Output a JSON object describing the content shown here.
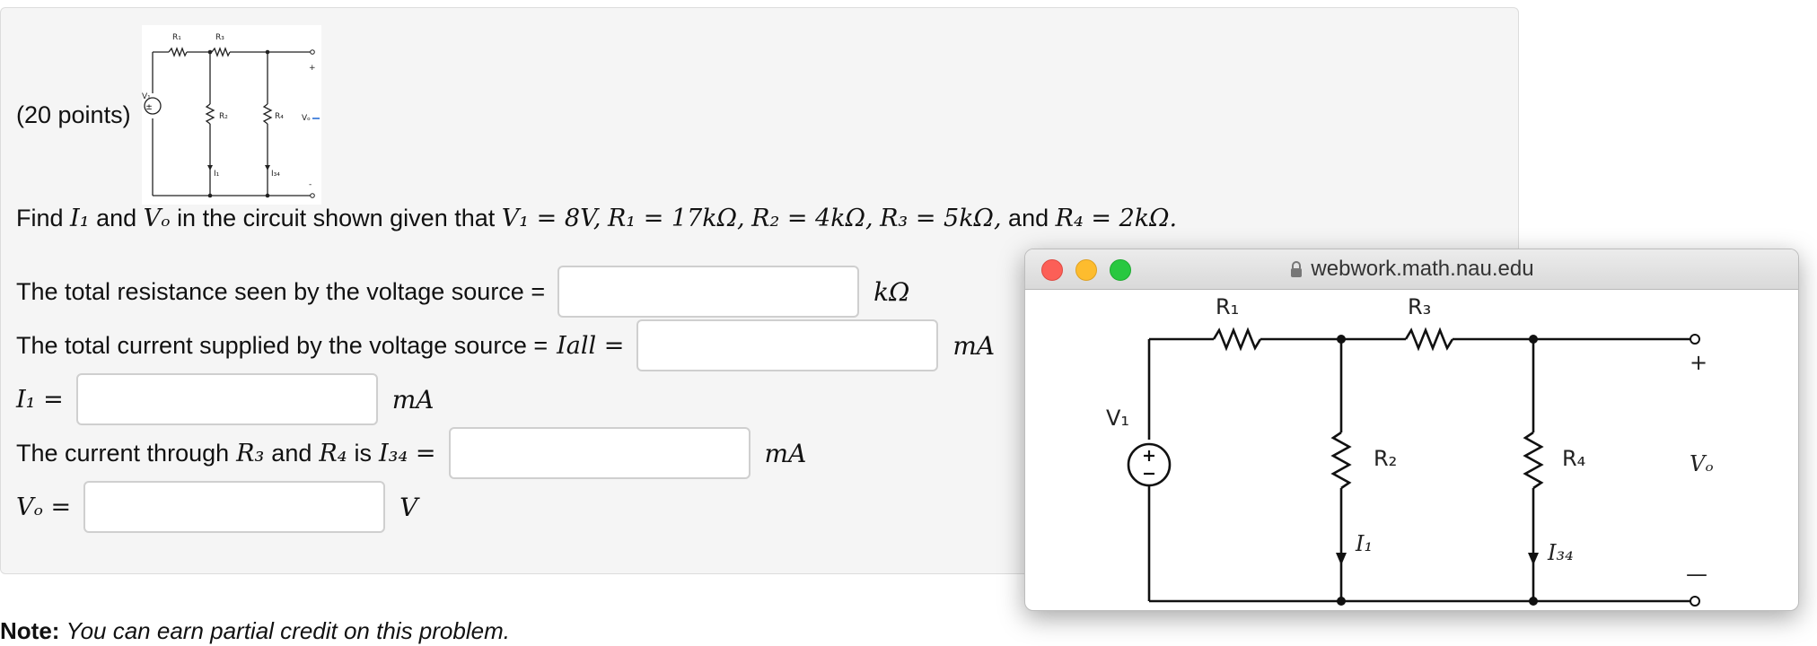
{
  "problem": {
    "points": "(20 points)",
    "statement": {
      "find": "Find",
      "var1": "I₁",
      "and1": "and",
      "var2": "Vₒ",
      "rest": "in the circuit shown given that",
      "v1": "V₁ = 8V,",
      "r1": "R₁ = 17kΩ,",
      "r2": "R₂ = 4kΩ,",
      "r3": "R₃ = 5kΩ,",
      "and2": "and",
      "r4": "R₄ = 2kΩ."
    },
    "questions": [
      {
        "prefix_text": "The total resistance seen by the voltage source =",
        "math": "",
        "unit": "kΩ",
        "value": ""
      },
      {
        "prefix_text": "The total current supplied by the voltage source =",
        "math": "Iall =",
        "unit": "mA",
        "value": ""
      },
      {
        "prefix_text": "",
        "math": "I₁ =",
        "unit": "mA",
        "value": ""
      },
      {
        "prefix_text": "The current through",
        "math_r3": "R₃",
        "and_text": "and",
        "math_r4": "R₄",
        "is_text": "is",
        "math": "I₃₄ =",
        "unit": "mA",
        "value": ""
      },
      {
        "prefix_text": "",
        "math": "Vₒ =",
        "unit": "V",
        "value": ""
      }
    ],
    "note_label": "Note:",
    "note_text": "You can earn partial credit on this problem."
  },
  "popup": {
    "url": "webwork.math.nau.edu",
    "circuit": {
      "labels": {
        "r1": "R₁",
        "r2": "R₂",
        "r3": "R₃",
        "r4": "R₄",
        "v1": "V₁",
        "vo": "Vₒ",
        "i1": "I₁",
        "i34": "I₃₄",
        "plus": "+",
        "minus": "—"
      }
    }
  },
  "thumbnail": {
    "labels": {
      "r1": "R₁",
      "r2": "R₂",
      "r3": "R₃",
      "r4": "R₄",
      "v1": "V₁",
      "vo": "Vₒ",
      "i1": "I₁",
      "i34": "I₃₄",
      "plus": "+",
      "minus": "-"
    }
  },
  "colors": {
    "close": "#fc5f57",
    "minimize": "#fdbc2e",
    "maximize": "#28c840",
    "vo_marker": "#2a6fd6"
  }
}
